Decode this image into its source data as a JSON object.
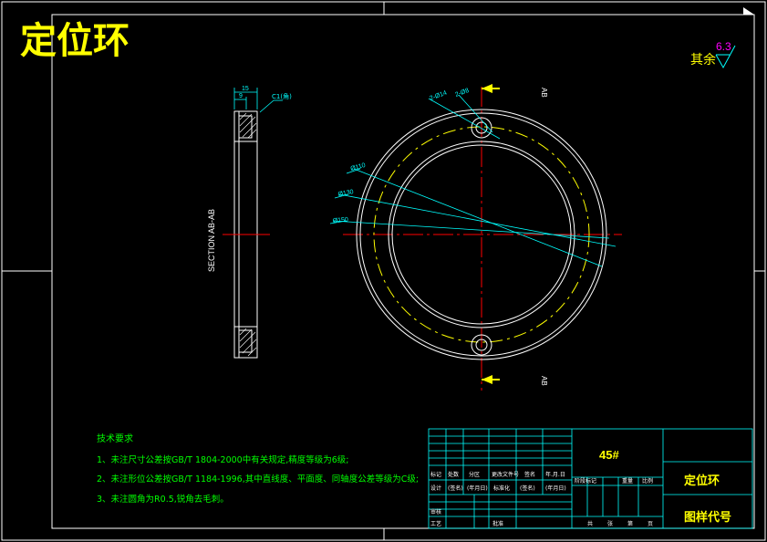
{
  "title": "定位环",
  "roughness": {
    "prefix": "其余",
    "value": "6.3"
  },
  "section_label": "SECTION AB-AB",
  "section_marks": {
    "top": "AB",
    "bottom": "AB"
  },
  "dims": {
    "width_total": "15",
    "width_inner": "9",
    "chamfer": "C1(角)",
    "holes_a": "2-Ø14",
    "holes_b": "2-Ø8",
    "d1": "Ø110",
    "d2": "Ø130",
    "d3": "Ø150"
  },
  "notes": {
    "heading": "技术要求",
    "items": [
      "1、未注尺寸公差按GB/T 1804-2000中有关规定,精度等级为6级;",
      "2、未注形位公差按GB/T 1184-1996,其中直线度、平面度、同轴度公差等级为C级;",
      "3、未注圆角为R0.5,锐角去毛刺。"
    ]
  },
  "title_block": {
    "material": "45#",
    "part_name": "定位环",
    "drawing_code": "图样代号",
    "row1": [
      "标记",
      "处数",
      "分区",
      "更改文件号",
      "签名",
      "年.月.日"
    ],
    "row2": [
      "设计",
      "(签名)",
      "(年月日)",
      "标准化",
      "(签名)",
      "(年月日)"
    ],
    "row3": [
      "审核"
    ],
    "row4": [
      "工艺",
      "批准"
    ],
    "stage_header": [
      "阶段标记",
      "重量",
      "比例"
    ],
    "sheet_info": [
      "共",
      "张",
      "第",
      "页"
    ]
  },
  "colors": {
    "frame": "#ffffff",
    "title": "#ffff00",
    "notes": "#00ff00",
    "block": "#00ffff",
    "dim": "#00ffff",
    "center": "#ff0000",
    "accent": "#ff00ff"
  }
}
